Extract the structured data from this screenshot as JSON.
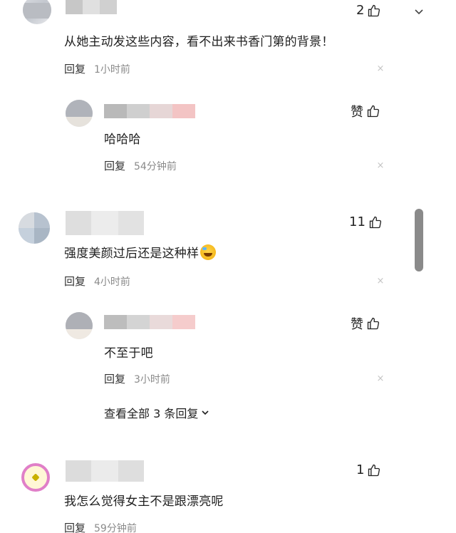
{
  "comments": [
    {
      "text": "从她主动发这些内容，看不出来书香门第的背景！",
      "time": "1小时前",
      "reply_label": "回复",
      "like_count": "2"
    },
    {
      "text": "哈哈哈",
      "time": "54分钟前",
      "reply_label": "回复",
      "like_label": "赞"
    },
    {
      "text": "强度美颜过后还是这种样",
      "time": "4小时前",
      "reply_label": "回复",
      "like_count": "11"
    },
    {
      "text": "不至于吧",
      "time": "3小时前",
      "reply_label": "回复",
      "like_label": "赞"
    },
    {
      "text": "我怎么觉得女主不是跟漂亮呢",
      "time": "59分钟前",
      "reply_label": "回复",
      "like_count": "1"
    }
  ],
  "expand_replies": "查看全部 3 条回复",
  "icons": {
    "like": "thumbs-up-icon",
    "close": "close-icon",
    "chevron": "chevron-down-icon",
    "emoji": "grinning-sweat-emoji-icon"
  }
}
